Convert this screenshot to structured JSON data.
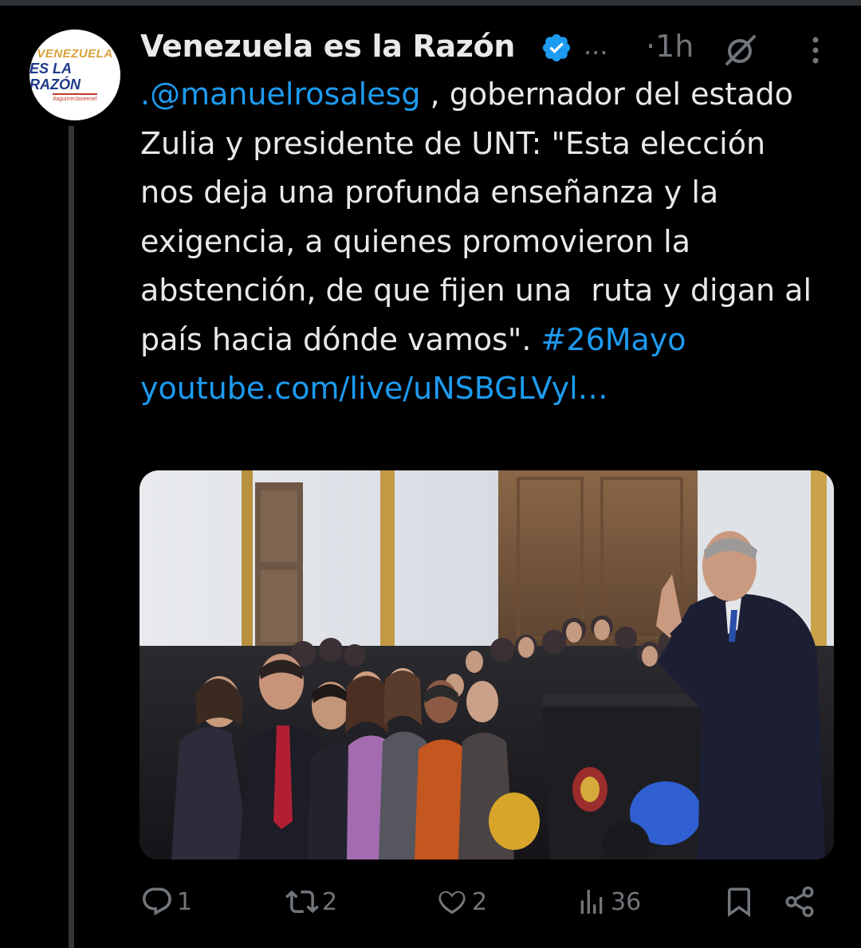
{
  "tweet": {
    "author_name": "Venezuela es la Razón",
    "handle_ellipsis": "...",
    "time": "·1h",
    "avatar": {
      "line1": "VENEZUELA",
      "line2": "ES LA RAZÓN",
      "line3": "#aguirreclaseenel"
    },
    "text_mention": ".@manuelrosalesg",
    "text_body": " , gobernador del estado Zulia y presidente de UNT: \"Esta elección nos deja una profunda enseñanza y la exigencia, a quienes promovieron la abstención, de que fijen una  ruta y digan al país hacia dónde vamos\". ",
    "hashtag": "#26Mayo",
    "url": "youtube.com/live/uNSBGLVyl…"
  },
  "actions": {
    "replies": "1",
    "reposts": "2",
    "likes": "2",
    "views": "36"
  },
  "colors": {
    "background": "#000000",
    "text": "#e7e9ea",
    "muted": "#71767b",
    "link": "#1d9bf0",
    "verified": "#1d9bf0"
  }
}
